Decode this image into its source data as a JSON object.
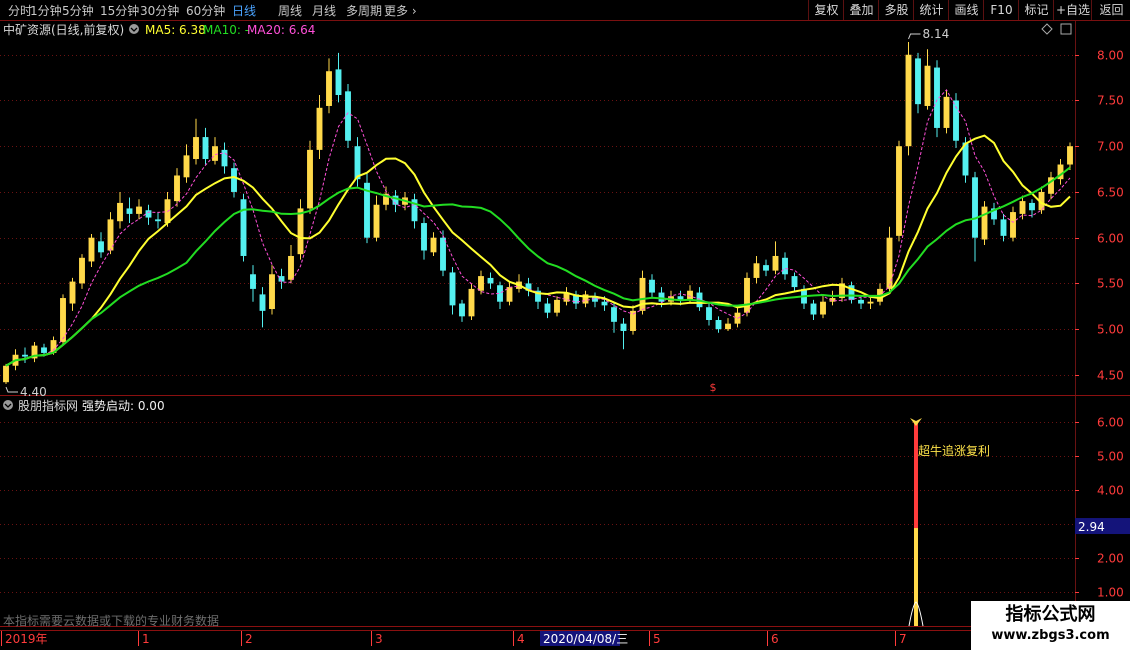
{
  "toolbar": {
    "periods": [
      "分时",
      "1分钟",
      "5分钟",
      "15分钟",
      "30分钟",
      "60分钟",
      "日线",
      "周线",
      "月线",
      "多周期",
      "更多"
    ],
    "active_period": "日线",
    "right_buttons": [
      "复权",
      "叠加",
      "多股",
      "统计",
      "画线",
      "F10",
      "标记",
      "+自选",
      "返回"
    ]
  },
  "main_panel": {
    "title": "中矿资源(日线,前复权)",
    "ma5_label": "MA5: 6.38",
    "ma10_label": "MA10: -",
    "ma20_label": "MA20: 6.64",
    "low_marker": "4.40",
    "high_marker": "8.14",
    "event_marker": "$"
  },
  "indicator_panel": {
    "title": "股朋指标网",
    "indicator_label": "强势启动: 0.00",
    "signal_text": "超牛追涨复利",
    "current_value": "2.94",
    "notice": "本指标需要云数据或下载的专业财务数据"
  },
  "time_axis": {
    "labels": [
      "2019年",
      "1",
      "2",
      "3",
      "4",
      "5",
      "6",
      "7"
    ],
    "cursor_date": "2020/04/08/三"
  },
  "watermark": {
    "line1": "指标公式网",
    "line2": "www.zbgs3.com"
  },
  "colors": {
    "up": "#ffd94a",
    "down": "#54f0f0",
    "ma5": "#ff4fd8",
    "ma10": "#ffff30",
    "ma20": "#22dd22",
    "axis_red": "#ff3b3b",
    "grid": "#6a1212"
  },
  "chart_data": [
    {
      "type": "candlestick",
      "title": "中矿资源(日线,前复权)",
      "y_ticks": [
        4.5,
        5.0,
        5.5,
        6.0,
        6.5,
        7.0,
        7.5,
        8.0
      ],
      "ylim": [
        4.28,
        8.38
      ],
      "x_labels": [
        "2019年",
        "1",
        "2",
        "3",
        "4",
        "5",
        "6",
        "7"
      ],
      "annotations": [
        {
          "label": "4.40",
          "kind": "low"
        },
        {
          "label": "8.14",
          "kind": "high"
        }
      ],
      "candles": [
        [
          4.42,
          4.6,
          4.4,
          4.62
        ],
        [
          4.6,
          4.72,
          4.55,
          4.78
        ],
        [
          4.72,
          4.7,
          4.63,
          4.8
        ],
        [
          4.68,
          4.82,
          4.64,
          4.86
        ],
        [
          4.8,
          4.74,
          4.7,
          4.84
        ],
        [
          4.74,
          4.88,
          4.72,
          4.92
        ],
        [
          4.86,
          5.34,
          4.84,
          5.38
        ],
        [
          5.28,
          5.52,
          5.2,
          5.56
        ],
        [
          5.5,
          5.78,
          5.44,
          5.82
        ],
        [
          5.74,
          6.0,
          5.68,
          6.04
        ],
        [
          5.96,
          5.84,
          5.78,
          6.06
        ],
        [
          5.86,
          6.2,
          5.82,
          6.28
        ],
        [
          6.18,
          6.38,
          6.1,
          6.5
        ],
        [
          6.32,
          6.26,
          6.16,
          6.44
        ],
        [
          6.26,
          6.34,
          6.2,
          6.42
        ],
        [
          6.3,
          6.22,
          6.14,
          6.36
        ],
        [
          6.2,
          6.18,
          6.1,
          6.28
        ],
        [
          6.16,
          6.42,
          6.12,
          6.5
        ],
        [
          6.4,
          6.68,
          6.34,
          6.76
        ],
        [
          6.66,
          6.9,
          6.6,
          7.02
        ],
        [
          6.86,
          7.1,
          6.8,
          7.3
        ],
        [
          7.1,
          6.86,
          6.8,
          7.2
        ],
        [
          6.84,
          7.0,
          6.8,
          7.1
        ],
        [
          6.96,
          6.78,
          6.7,
          7.04
        ],
        [
          6.76,
          6.5,
          6.44,
          6.82
        ],
        [
          6.42,
          5.8,
          5.74,
          6.48
        ],
        [
          5.6,
          5.44,
          5.3,
          5.7
        ],
        [
          5.38,
          5.2,
          5.02,
          5.46
        ],
        [
          5.22,
          5.6,
          5.16,
          5.7
        ],
        [
          5.58,
          5.52,
          5.44,
          5.66
        ],
        [
          5.54,
          5.8,
          5.5,
          5.92
        ],
        [
          5.82,
          6.32,
          5.76,
          6.42
        ],
        [
          6.32,
          6.96,
          6.26,
          7.06
        ],
        [
          6.96,
          7.42,
          6.86,
          7.56
        ],
        [
          7.44,
          7.82,
          7.36,
          7.96
        ],
        [
          7.84,
          7.56,
          7.48,
          8.02
        ],
        [
          7.6,
          7.06,
          6.98,
          7.68
        ],
        [
          7.0,
          6.64,
          6.56,
          7.1
        ],
        [
          6.6,
          6.0,
          5.94,
          6.7
        ],
        [
          6.0,
          6.36,
          5.96,
          6.46
        ],
        [
          6.36,
          6.48,
          6.3,
          6.56
        ],
        [
          6.46,
          6.36,
          6.28,
          6.52
        ],
        [
          6.36,
          6.44,
          6.3,
          6.5
        ],
        [
          6.42,
          6.18,
          6.1,
          6.48
        ],
        [
          6.16,
          5.86,
          5.76,
          6.22
        ],
        [
          5.84,
          6.0,
          5.8,
          6.06
        ],
        [
          6.0,
          5.64,
          5.58,
          6.08
        ],
        [
          5.62,
          5.26,
          5.16,
          5.68
        ],
        [
          5.28,
          5.14,
          5.08,
          5.32
        ],
        [
          5.14,
          5.44,
          5.1,
          5.5
        ],
        [
          5.42,
          5.58,
          5.38,
          5.64
        ],
        [
          5.56,
          5.5,
          5.44,
          5.62
        ],
        [
          5.48,
          5.3,
          5.22,
          5.52
        ],
        [
          5.3,
          5.46,
          5.26,
          5.52
        ],
        [
          5.44,
          5.52,
          5.4,
          5.6
        ],
        [
          5.5,
          5.42,
          5.36,
          5.56
        ],
        [
          5.42,
          5.3,
          5.22,
          5.46
        ],
        [
          5.28,
          5.18,
          5.12,
          5.34
        ],
        [
          5.18,
          5.32,
          5.14,
          5.36
        ],
        [
          5.3,
          5.4,
          5.26,
          5.46
        ],
        [
          5.38,
          5.28,
          5.22,
          5.42
        ],
        [
          5.28,
          5.38,
          5.24,
          5.42
        ],
        [
          5.36,
          5.3,
          5.24,
          5.4
        ],
        [
          5.3,
          5.26,
          5.2,
          5.36
        ],
        [
          5.24,
          5.08,
          4.96,
          5.3
        ],
        [
          5.06,
          4.98,
          4.78,
          5.12
        ],
        [
          4.98,
          5.2,
          4.94,
          5.26
        ],
        [
          5.2,
          5.56,
          5.16,
          5.64
        ],
        [
          5.54,
          5.4,
          5.34,
          5.6
        ],
        [
          5.4,
          5.3,
          5.24,
          5.46
        ],
        [
          5.3,
          5.36,
          5.26,
          5.42
        ],
        [
          5.36,
          5.32,
          5.26,
          5.42
        ],
        [
          5.32,
          5.42,
          5.28,
          5.48
        ],
        [
          5.4,
          5.24,
          5.2,
          5.46
        ],
        [
          5.24,
          5.1,
          5.04,
          5.28
        ],
        [
          5.1,
          5.0,
          4.96,
          5.14
        ],
        [
          5.0,
          5.06,
          4.98,
          5.12
        ],
        [
          5.06,
          5.18,
          5.02,
          5.24
        ],
        [
          5.18,
          5.56,
          5.14,
          5.62
        ],
        [
          5.56,
          5.72,
          5.5,
          5.8
        ],
        [
          5.7,
          5.64,
          5.58,
          5.76
        ],
        [
          5.64,
          5.8,
          5.6,
          5.96
        ],
        [
          5.78,
          5.6,
          5.54,
          5.84
        ],
        [
          5.58,
          5.46,
          5.4,
          5.62
        ],
        [
          5.44,
          5.28,
          5.22,
          5.48
        ],
        [
          5.28,
          5.16,
          5.1,
          5.32
        ],
        [
          5.16,
          5.3,
          5.12,
          5.36
        ],
        [
          5.3,
          5.34,
          5.26,
          5.42
        ],
        [
          5.34,
          5.5,
          5.3,
          5.56
        ],
        [
          5.48,
          5.32,
          5.28,
          5.52
        ],
        [
          5.32,
          5.28,
          5.22,
          5.36
        ],
        [
          5.28,
          5.3,
          5.22,
          5.34
        ],
        [
          5.3,
          5.44,
          5.26,
          5.5
        ],
        [
          5.44,
          6.0,
          5.4,
          6.12
        ],
        [
          6.02,
          7.0,
          5.96,
          7.06
        ],
        [
          7.0,
          8.0,
          6.9,
          8.14
        ],
        [
          7.96,
          7.46,
          7.36,
          8.02
        ],
        [
          7.44,
          7.88,
          7.4,
          8.06
        ],
        [
          7.86,
          7.2,
          7.1,
          7.94
        ],
        [
          7.2,
          7.54,
          7.14,
          7.62
        ],
        [
          7.5,
          7.06,
          6.98,
          7.58
        ],
        [
          7.04,
          6.68,
          6.6,
          7.1
        ],
        [
          6.66,
          6.0,
          5.74,
          6.72
        ],
        [
          5.98,
          6.34,
          5.92,
          6.4
        ],
        [
          6.32,
          6.2,
          6.14,
          6.38
        ],
        [
          6.2,
          6.02,
          5.96,
          6.26
        ],
        [
          6.0,
          6.28,
          5.96,
          6.34
        ],
        [
          6.26,
          6.4,
          6.2,
          6.46
        ],
        [
          6.38,
          6.3,
          6.22,
          6.42
        ],
        [
          6.3,
          6.5,
          6.26,
          6.56
        ],
        [
          6.48,
          6.66,
          6.42,
          6.72
        ],
        [
          6.64,
          6.8,
          6.58,
          6.86
        ],
        [
          6.8,
          7.0,
          6.74,
          7.04
        ]
      ]
    },
    {
      "type": "line",
      "title": "股朋指标网",
      "y_ticks": [
        1.0,
        2.0,
        3.0,
        4.0,
        5.0,
        6.0
      ],
      "ylim": [
        0,
        6.5
      ],
      "series": [
        {
          "name": "强势启动",
          "signal_value": 6.0,
          "current_value": 2.94
        }
      ]
    }
  ]
}
